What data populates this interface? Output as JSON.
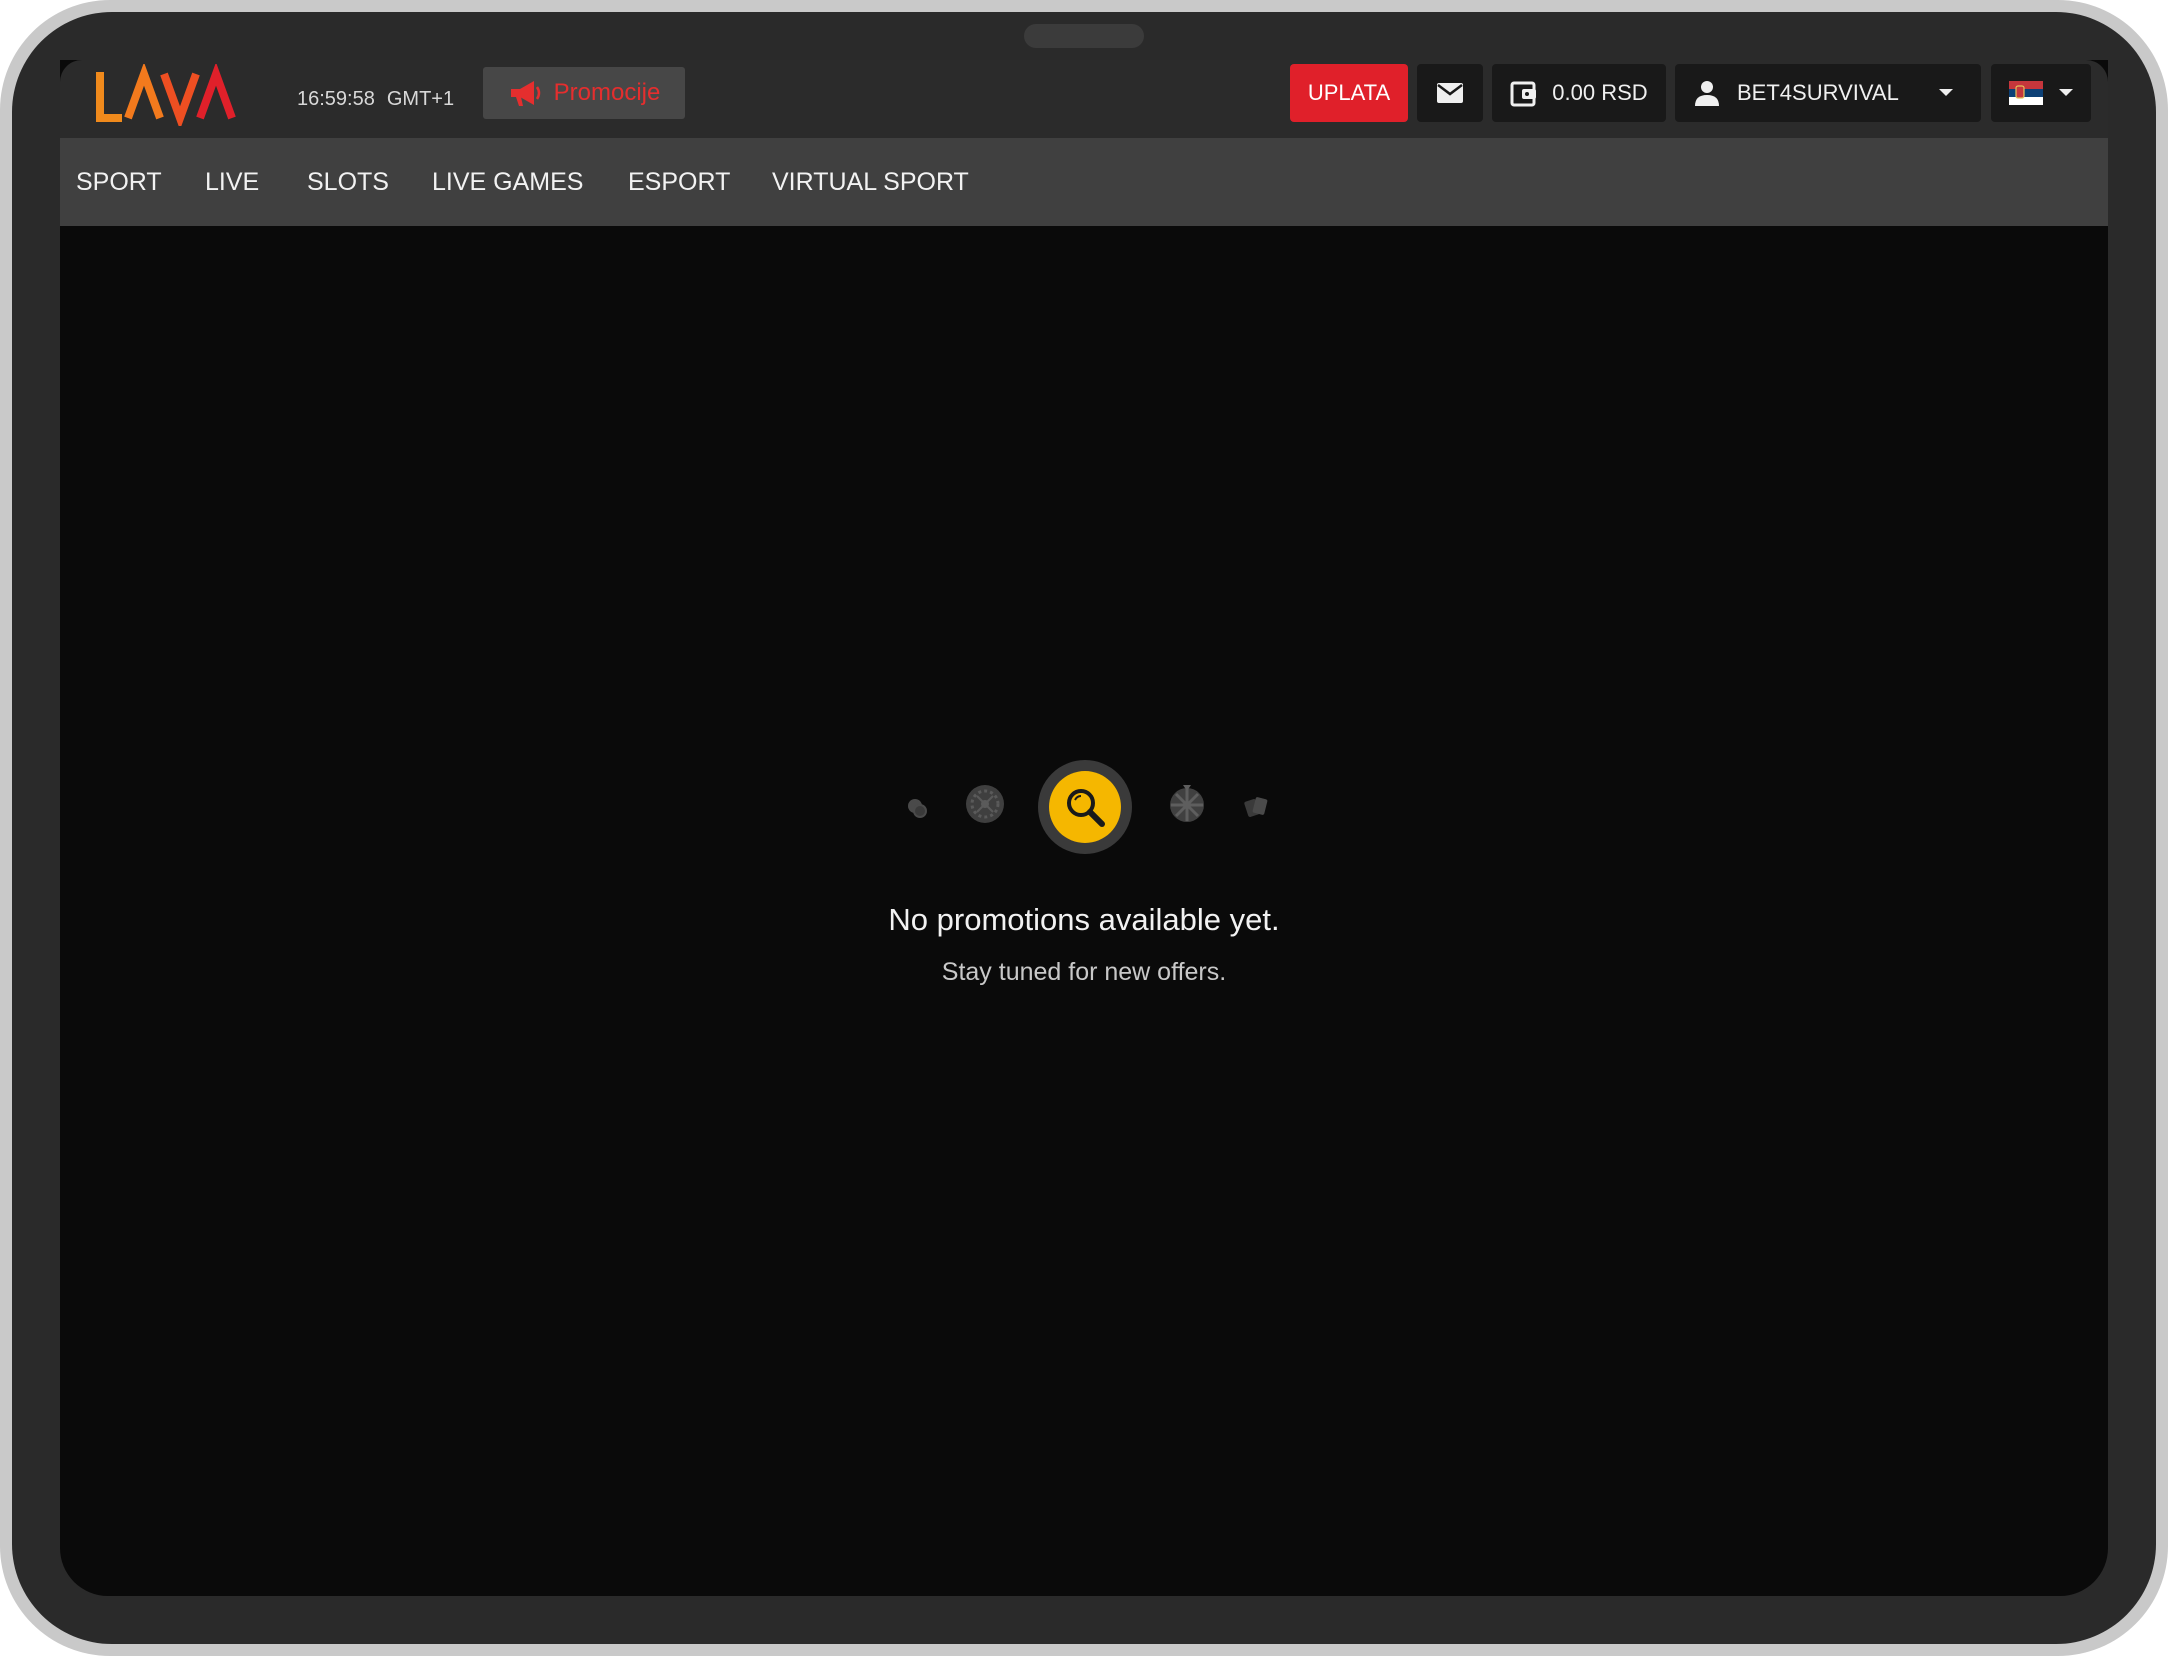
{
  "brand": {
    "logo_text": "LAVA",
    "logo_color": "#f07a1a",
    "logo_accent_color": "#e0202a"
  },
  "header": {
    "time": "16:59:58",
    "timezone": "GMT+1",
    "promo_label": "Promocije",
    "promo_icon": "megaphone-icon",
    "deposit_label": "UPLATA",
    "mail_icon": "envelope-icon",
    "balance": "0.00 RSD",
    "wallet_icon": "wallet-icon",
    "username": "BET4SURVIVAL",
    "user_icon": "user-icon",
    "language_icon": "serbia-flag-icon"
  },
  "nav": {
    "items": [
      {
        "label": "SPORT"
      },
      {
        "label": "LIVE"
      },
      {
        "label": "SLOTS"
      },
      {
        "label": "LIVE GAMES"
      },
      {
        "label": "ESPORT"
      },
      {
        "label": "VIRTUAL SPORT"
      }
    ]
  },
  "empty_state": {
    "title": "No promotions available yet.",
    "subtitle": "Stay tuned for new offers.",
    "icons": [
      "chips-icon",
      "roulette-icon",
      "search-icon",
      "wheel-icon",
      "cards-icon"
    ]
  },
  "colors": {
    "accent_red": "#e0202a",
    "accent_yellow": "#f5b700",
    "background": "#0a0a0a"
  }
}
